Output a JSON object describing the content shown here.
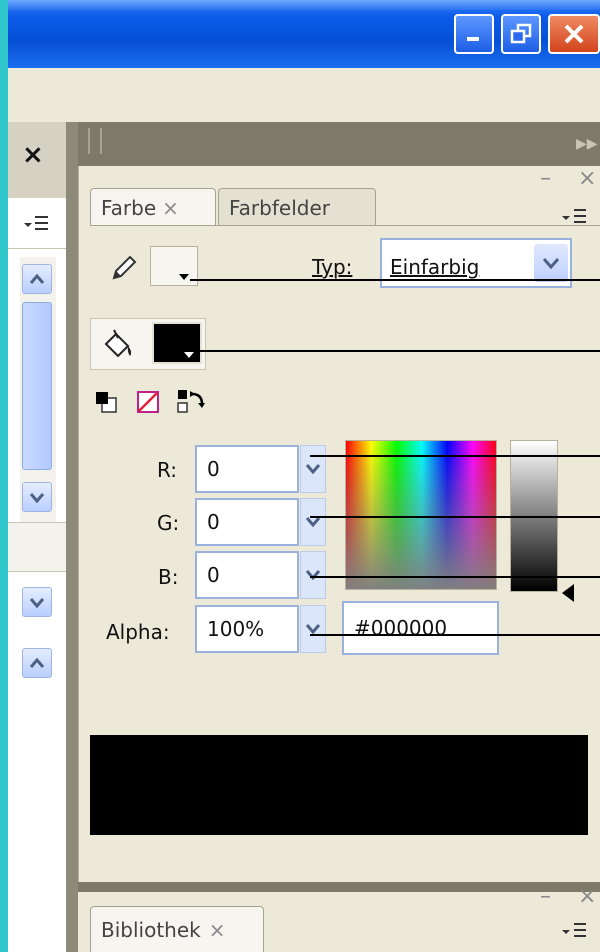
{
  "window": {
    "buttons": [
      {
        "name": "minimize-button",
        "icon": "minimize-icon"
      },
      {
        "name": "restore-button",
        "icon": "restore-icon"
      },
      {
        "name": "close-button",
        "icon": "close-icon"
      }
    ]
  },
  "left_panel": {
    "close_glyph": "×",
    "menu_icon": "panel-menu-icon"
  },
  "color_panel": {
    "tabs": [
      {
        "label": "Farbe",
        "close": "×",
        "active": true
      },
      {
        "label": "Farbfelder",
        "active": false
      }
    ],
    "panel_controls": {
      "minimize": "–",
      "close": "×"
    },
    "type_label": "Typ:",
    "type_value": "Einfarbig",
    "stroke_color": "#ffffff",
    "fill_color": "#000000",
    "fields": {
      "r_label": "R:",
      "r_value": "0",
      "g_label": "G:",
      "g_value": "0",
      "b_label": "B:",
      "b_value": "0",
      "alpha_label": "Alpha:",
      "alpha_value": "100%",
      "hex_value": "#000000"
    },
    "preview_color": "#000000"
  },
  "library_panel": {
    "tab_label": "Bibliothek",
    "tab_close": "×",
    "panel_controls": {
      "minimize": "–",
      "close": "×"
    }
  },
  "colors": {
    "title_blue": "#0650d6",
    "teal_background": "#2fc6cc",
    "panel_bg": "#ece9d8"
  }
}
